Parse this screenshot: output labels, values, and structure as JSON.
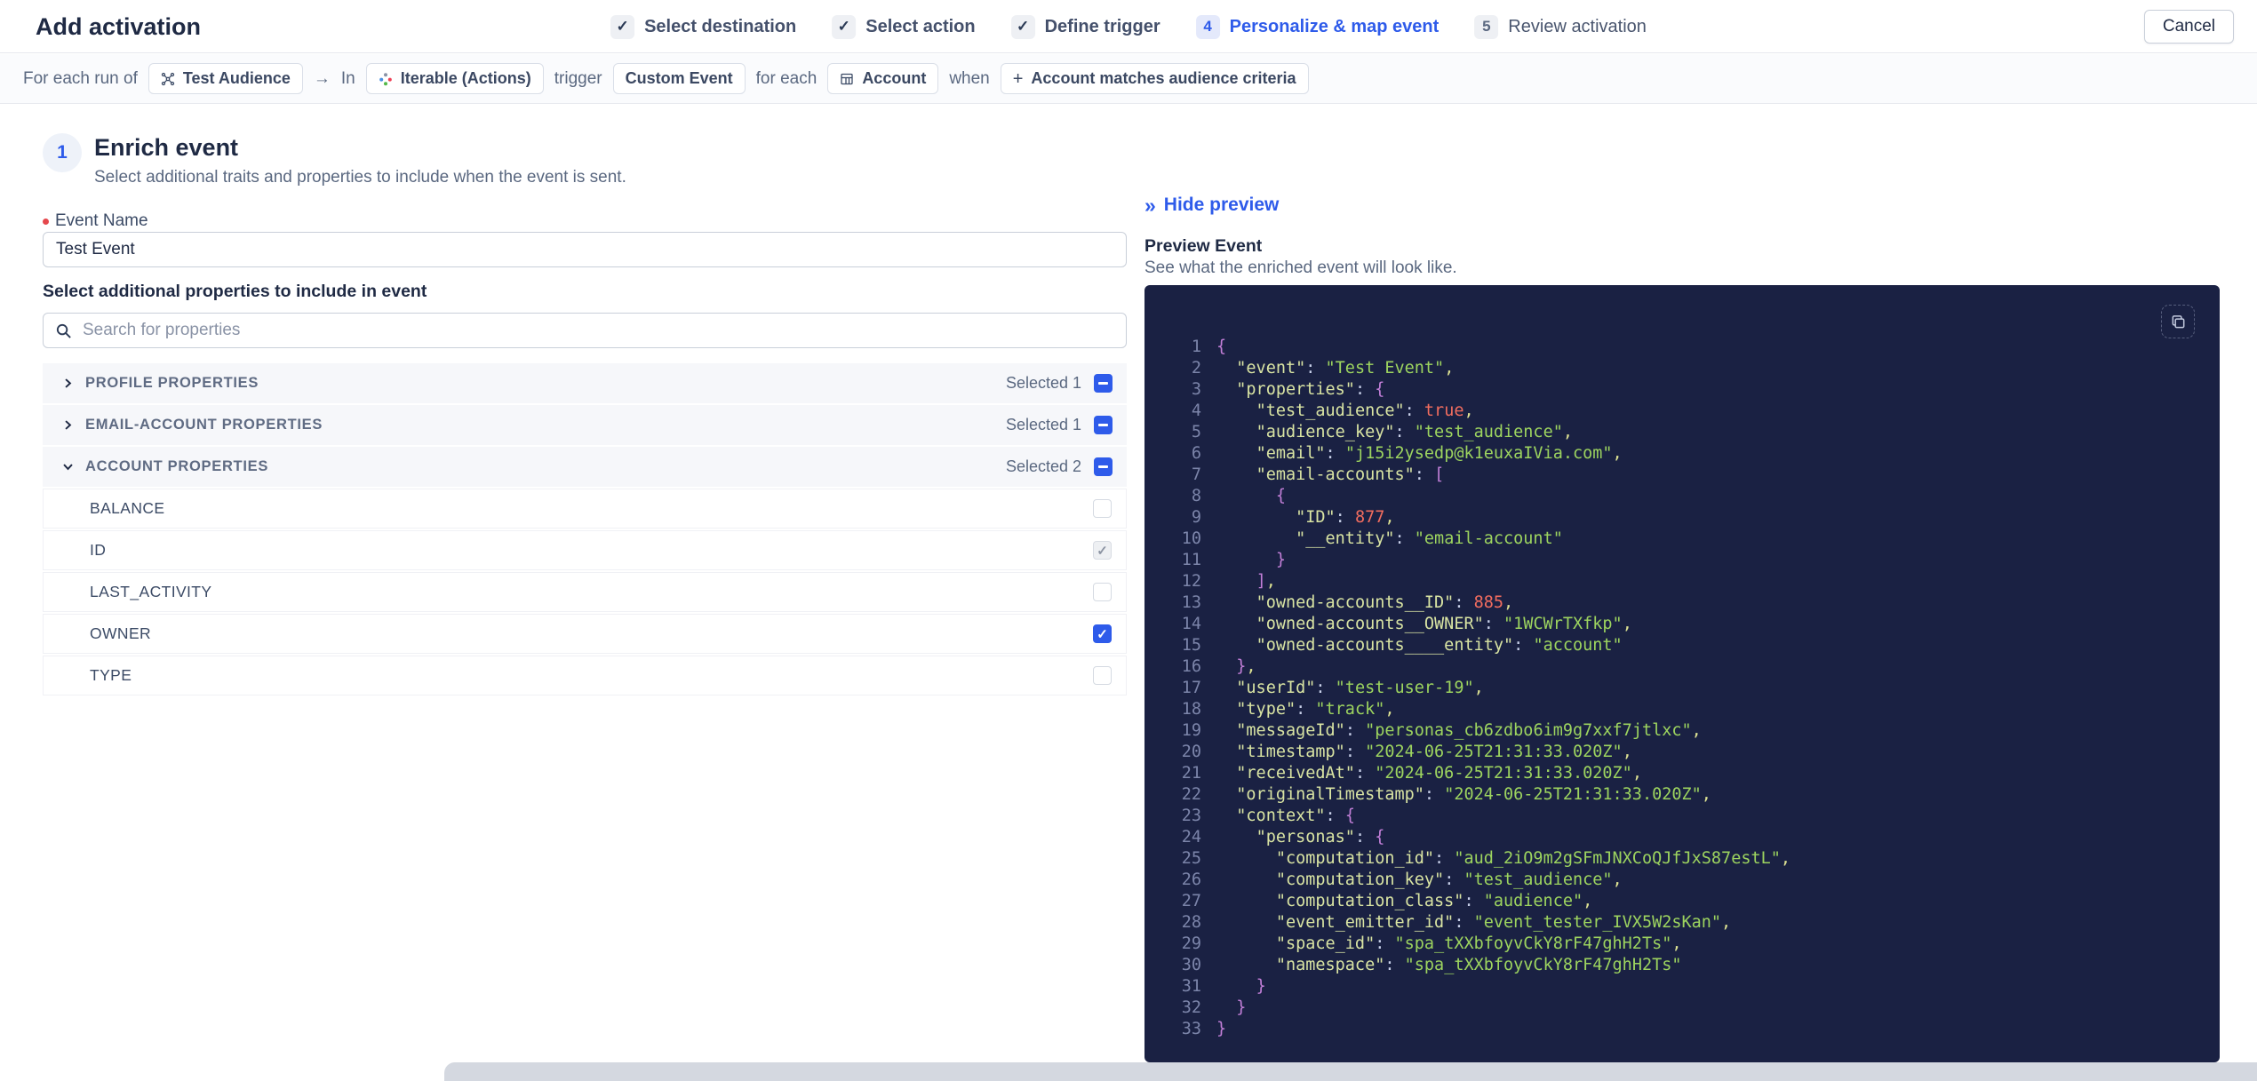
{
  "header": {
    "title": "Add activation",
    "cancel_label": "Cancel",
    "steps": [
      {
        "label": "Select destination",
        "state": "done"
      },
      {
        "label": "Select action",
        "state": "done"
      },
      {
        "label": "Define trigger",
        "state": "done"
      },
      {
        "label": "Personalize & map event",
        "state": "current",
        "number": "4"
      },
      {
        "label": "Review activation",
        "state": "upcoming",
        "number": "5"
      }
    ]
  },
  "ribbon": {
    "segments": [
      {
        "type": "text",
        "text": "For each run of"
      },
      {
        "type": "chip",
        "icon": "audience-icon",
        "text": "Test Audience"
      },
      {
        "type": "text",
        "text": "→"
      },
      {
        "type": "text",
        "text": "In"
      },
      {
        "type": "chip",
        "icon": "iterable-icon",
        "text": "Iterable (Actions)"
      },
      {
        "type": "text",
        "text": "trigger"
      },
      {
        "type": "chip",
        "text": "Custom Event"
      },
      {
        "type": "text",
        "text": "for each"
      },
      {
        "type": "chip",
        "icon": "table-icon",
        "text": "Account"
      },
      {
        "type": "text",
        "text": "when"
      },
      {
        "type": "chip",
        "icon": "plus-icon",
        "text": "Account matches audience criteria"
      }
    ]
  },
  "enrich": {
    "step_number": "1",
    "title": "Enrich event",
    "subtitle": "Select additional traits and properties to include when the event is sent.",
    "event_name_label": "Event Name",
    "event_name_value": "Test Event",
    "properties_label": "Select additional properties to include in event",
    "search_placeholder": "Search for properties",
    "groups": [
      {
        "label": "PROFILE PROPERTIES",
        "selected_text": "Selected 1",
        "expanded": false,
        "items": []
      },
      {
        "label": "EMAIL-ACCOUNT PROPERTIES",
        "selected_text": "Selected 1",
        "expanded": false,
        "items": []
      },
      {
        "label": "ACCOUNT PROPERTIES",
        "selected_text": "Selected 2",
        "expanded": true,
        "items": [
          {
            "label": "BALANCE",
            "checked": false,
            "disabled": false
          },
          {
            "label": "ID",
            "checked": true,
            "disabled": true
          },
          {
            "label": "LAST_ACTIVITY",
            "checked": false,
            "disabled": false
          },
          {
            "label": "OWNER",
            "checked": true,
            "disabled": false
          },
          {
            "label": "TYPE",
            "checked": false,
            "disabled": false
          }
        ]
      }
    ]
  },
  "preview": {
    "hide_label": "Hide preview",
    "title": "Preview Event",
    "subtitle": "See what the enriched event will look like.",
    "code_lines": [
      "{",
      "  \"event\": \"Test Event\",",
      "  \"properties\": {",
      "    \"test_audience\": true,",
      "    \"audience_key\": \"test_audience\",",
      "    \"email\": \"j15i2ysedp@k1euxaIVia.com\",",
      "    \"email-accounts\": [",
      "      {",
      "        \"ID\": 877,",
      "        \"__entity\": \"email-account\"",
      "      }",
      "    ],",
      "    \"owned-accounts__ID\": 885,",
      "    \"owned-accounts__OWNER\": \"1WCWrTXfkp\",",
      "    \"owned-accounts____entity\": \"account\"",
      "  },",
      "  \"userId\": \"test-user-19\",",
      "  \"type\": \"track\",",
      "  \"messageId\": \"personas_cb6zdbo6im9g7xxf7jtlxc\",",
      "  \"timestamp\": \"2024-06-25T21:31:33.020Z\",",
      "  \"receivedAt\": \"2024-06-25T21:31:33.020Z\",",
      "  \"originalTimestamp\": \"2024-06-25T21:31:33.020Z\",",
      "  \"context\": {",
      "    \"personas\": {",
      "      \"computation_id\": \"aud_2iO9m2gSFmJNXCoQJfJxS87estL\",",
      "      \"computation_key\": \"test_audience\",",
      "      \"computation_class\": \"audience\",",
      "      \"event_emitter_id\": \"event_tester_IVX5W2sKan\",",
      "      \"space_id\": \"spa_tXXbfoyvCkY8rF47ghH2Ts\",",
      "      \"namespace\": \"spa_tXXbfoyvCkY8rF47ghH2Ts\"",
      "    }",
      "  }",
      "}"
    ]
  },
  "colors": {
    "accent": "#2e5bea",
    "danger": "#e5484d",
    "checkbox_blue": "#2e5bea",
    "code_bg": "#1a2143",
    "code_linenum": "#7c85aa",
    "code_key": "#d9e4a3",
    "code_string": "#9dd45f",
    "code_number": "#f26d5f",
    "code_brace": "#c27fd8",
    "code_colon": "#c7cfe8",
    "code_comma": "#dde293"
  }
}
